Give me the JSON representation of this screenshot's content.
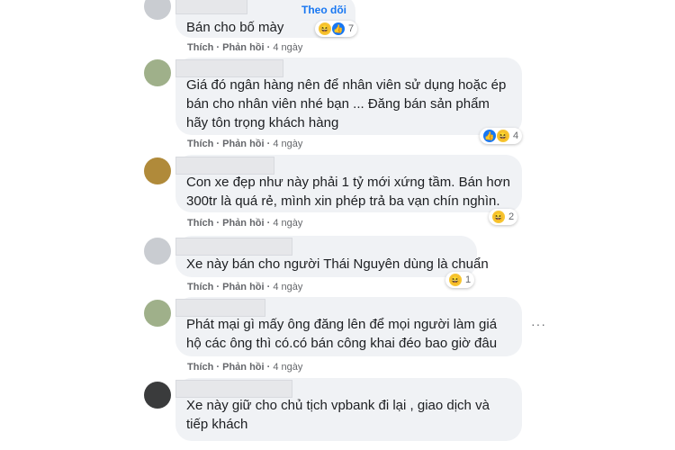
{
  "actions": {
    "like": "Thích",
    "reply": "Phản hồi",
    "sep": " · ",
    "time": "4 ngày"
  },
  "follow_label": "Theo dõi",
  "more_icon": "more-dots-icon",
  "comments": [
    {
      "text": "Bán cho bố mày",
      "reactions": {
        "icons": [
          "haha",
          "like"
        ],
        "count": "7"
      }
    },
    {
      "text": "Giá đó ngân hàng nên để nhân viên sử dụng hoặc ép bán cho nhân viên nhé bạn ... Đăng bán sản phẩm hãy tôn trọng khách hàng",
      "reactions": {
        "icons": [
          "like",
          "haha"
        ],
        "count": "4"
      }
    },
    {
      "text": "Con xe đẹp như này phải 1 tỷ mới xứng tầm. Bán hơn 300tr là quá rẻ, mình xin phép trả ba vạn chín nghìn.",
      "reactions": {
        "icons": [
          "haha"
        ],
        "count": "2"
      }
    },
    {
      "text": "Xe này bán cho người Thái Nguyên dùng là chuẩn",
      "reactions": {
        "icons": [
          "haha"
        ],
        "count": "1"
      }
    },
    {
      "text": "Phát mại gì mấy ông đăng lên để mọi người làm giá hộ các ông thì có.có bán công khai đéo bao giờ đâu",
      "reactions": null
    },
    {
      "text": "Xe này giữ cho chủ tịch vpbank đi lại , giao dịch và tiếp khách",
      "reactions": null
    }
  ]
}
